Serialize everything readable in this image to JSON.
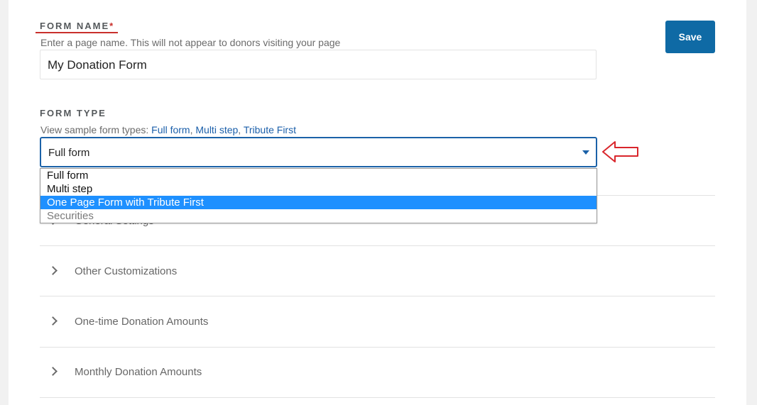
{
  "form_name": {
    "label": "FORM NAME",
    "required_marker": "*",
    "hint": "Enter a page name. This will not appear to donors visiting your page",
    "value": "My Donation Form"
  },
  "save_label": "Save",
  "form_type": {
    "label": "FORM TYPE",
    "hint_prefix": "View sample form types: ",
    "links": [
      "Full form",
      "Multi step",
      "Tribute First"
    ],
    "separator": ", ",
    "selected_value": "Full form",
    "options": [
      "Full form",
      "Multi step",
      "One Page Form with Tribute First",
      "Securities"
    ],
    "highlighted_option": "One Page Form with Tribute First"
  },
  "sections": [
    {
      "label": "General Settings"
    },
    {
      "label": "Other Customizations"
    },
    {
      "label": "One-time Donation Amounts"
    },
    {
      "label": "Monthly Donation Amounts"
    }
  ],
  "colors": {
    "accent": "#0f6aa5",
    "required": "#c9302c",
    "highlight": "#1e90ff",
    "annotation_arrow": "#d9262c"
  },
  "icons": {
    "section_toggle": "chevron-right-icon",
    "select_caret": "caret-down-icon",
    "annotation": "arrow-left-outline-icon"
  }
}
